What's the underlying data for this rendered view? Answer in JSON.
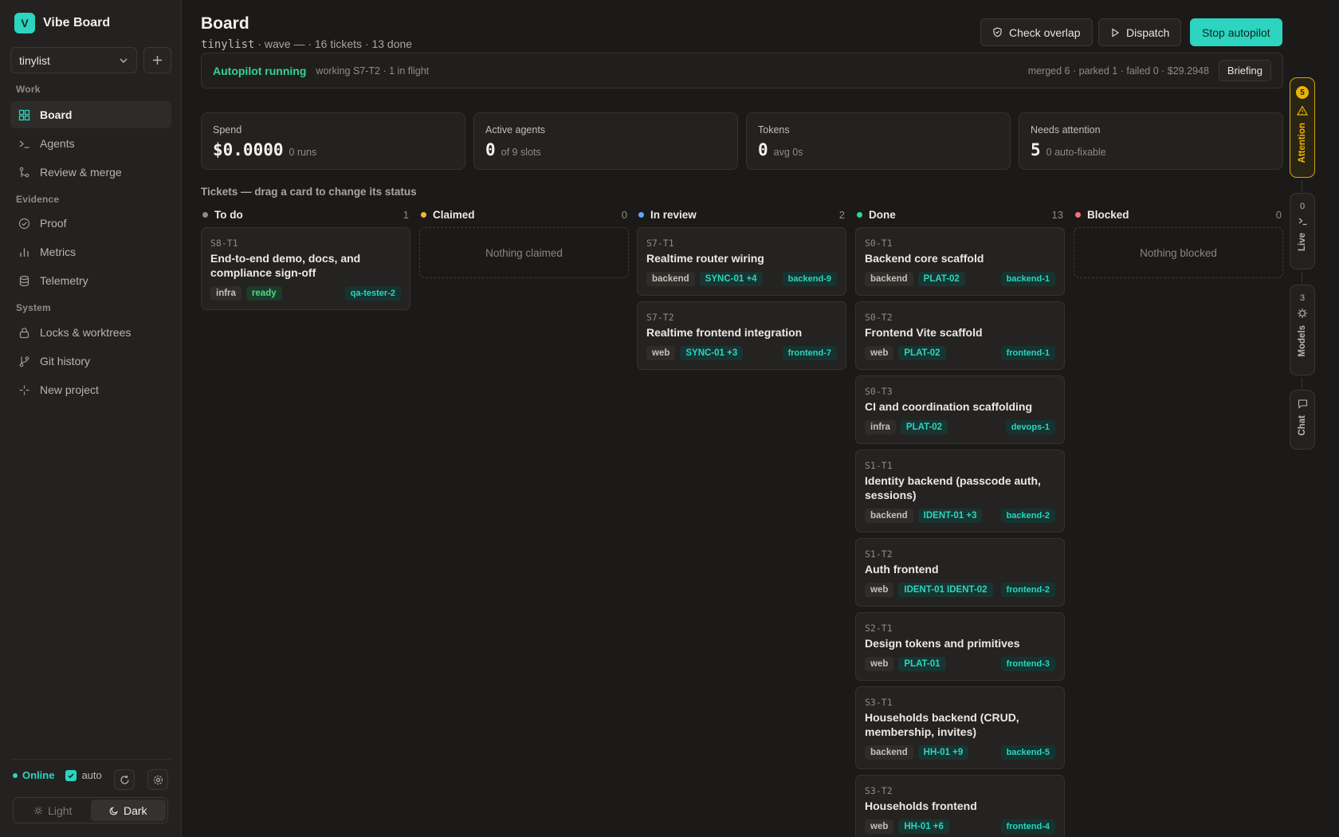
{
  "brand": {
    "logo_letter": "V",
    "name": "Vibe Board"
  },
  "project": {
    "selected": "tinylist"
  },
  "nav": {
    "sections": [
      {
        "label": "Work"
      },
      {
        "label": "Evidence"
      },
      {
        "label": "System"
      }
    ],
    "items": [
      {
        "label": "Board",
        "icon": "grid-icon",
        "active": true
      },
      {
        "label": "Agents",
        "icon": "terminal-icon"
      },
      {
        "label": "Review & merge",
        "icon": "git-merge-icon"
      },
      {
        "label": "Proof",
        "icon": "check-circle-icon"
      },
      {
        "label": "Metrics",
        "icon": "bar-chart-icon"
      },
      {
        "label": "Telemetry",
        "icon": "database-icon"
      },
      {
        "label": "Locks & worktrees",
        "icon": "lock-icon"
      },
      {
        "label": "Git history",
        "icon": "git-branch-icon"
      },
      {
        "label": "New project",
        "icon": "sparkle-icon"
      }
    ]
  },
  "footer": {
    "status": "Online",
    "auto_label": "auto",
    "auto_checked": true,
    "theme_light": "Light",
    "theme_dark": "Dark",
    "theme_selected": "Dark"
  },
  "header": {
    "title": "Board",
    "project_code": "tinylist",
    "subtitle": " · wave — · 16 tickets · 13 done",
    "check_overlap": "Check overlap",
    "dispatch": "Dispatch",
    "stop_autopilot": "Stop autopilot"
  },
  "autopilot": {
    "status": "Autopilot running",
    "working": "working S7-T2 · 1 in flight",
    "stats": "merged 6 · parked 1 · failed 0 · $29.2948",
    "briefing": "Briefing"
  },
  "stats": [
    {
      "label": "Spend",
      "value": "$0.0000",
      "sub": "0 runs"
    },
    {
      "label": "Active agents",
      "value": "0",
      "sub": "of 9 slots"
    },
    {
      "label": "Tokens",
      "value": "0",
      "sub": "avg 0s"
    },
    {
      "label": "Needs attention",
      "value": "5",
      "sub": "0 auto-fixable"
    }
  ],
  "board_hint": "Tickets — drag a card to change its status",
  "columns": [
    {
      "name": "To do",
      "count": "1",
      "color": "#8f8b84",
      "empty": ""
    },
    {
      "name": "Claimed",
      "count": "0",
      "color": "#f5b73b",
      "empty": "Nothing claimed"
    },
    {
      "name": "In review",
      "count": "2",
      "color": "#60a5fa",
      "empty": ""
    },
    {
      "name": "Done",
      "count": "13",
      "color": "#34d399",
      "empty": ""
    },
    {
      "name": "Blocked",
      "count": "0",
      "color": "#f87171",
      "empty": "Nothing blocked"
    }
  ],
  "cards": {
    "todo": [
      {
        "id": "S8-T1",
        "title": "End-to-end demo, docs, and compliance sign-off",
        "area": "infra",
        "req": "ready",
        "agent": "qa-tester-2"
      }
    ],
    "review": [
      {
        "id": "S7-T1",
        "title": "Realtime router wiring",
        "area": "backend",
        "req": "SYNC-01 +4",
        "agent": "backend-9"
      },
      {
        "id": "S7-T2",
        "title": "Realtime frontend integration",
        "area": "web",
        "req": "SYNC-01 +3",
        "agent": "frontend-7"
      }
    ],
    "done": [
      {
        "id": "S0-T1",
        "title": "Backend core scaffold",
        "area": "backend",
        "req": "PLAT-02",
        "agent": "backend-1"
      },
      {
        "id": "S0-T2",
        "title": "Frontend Vite scaffold",
        "area": "web",
        "req": "PLAT-02",
        "agent": "frontend-1"
      },
      {
        "id": "S0-T3",
        "title": "CI and coordination scaffolding",
        "area": "infra",
        "req": "PLAT-02",
        "agent": "devops-1"
      },
      {
        "id": "S1-T1",
        "title": "Identity backend (passcode auth, sessions)",
        "area": "backend",
        "req": "IDENT-01 +3",
        "agent": "backend-2"
      },
      {
        "id": "S1-T2",
        "title": "Auth frontend",
        "area": "web",
        "req": "IDENT-01 IDENT-02",
        "agent": "frontend-2"
      },
      {
        "id": "S2-T1",
        "title": "Design tokens and primitives",
        "area": "web",
        "req": "PLAT-01",
        "agent": "frontend-3"
      },
      {
        "id": "S3-T1",
        "title": "Households backend (CRUD, membership, invites)",
        "area": "backend",
        "req": "HH-01 +9",
        "agent": "backend-5"
      },
      {
        "id": "S3-T2",
        "title": "Households frontend",
        "area": "web",
        "req": "HH-01 +6",
        "agent": "frontend-4"
      }
    ]
  },
  "rail": {
    "attention": {
      "badge": "5",
      "label": "Attention"
    },
    "live": {
      "count": "0",
      "label": "Live"
    },
    "models": {
      "count": "3",
      "label": "Models"
    },
    "chat": {
      "label": "Chat"
    }
  },
  "colors": {
    "accent": "#2dd4bf",
    "ready": "#4ade80",
    "warning": "#eab308"
  }
}
